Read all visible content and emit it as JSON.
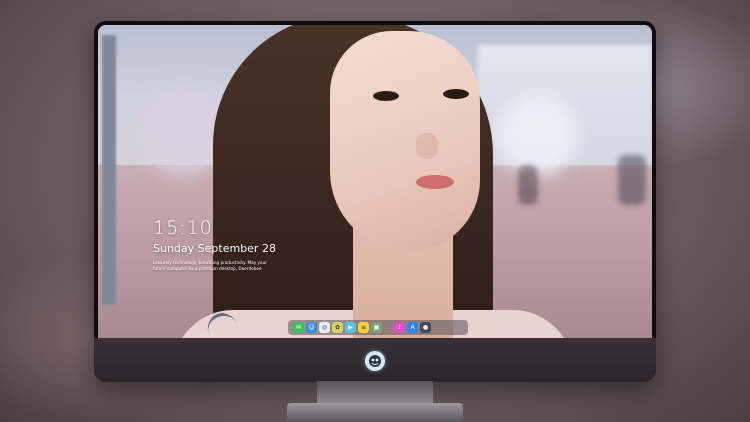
{
  "lockscreen": {
    "time": "15:10",
    "date": "Sunday September 28",
    "quote": "Leisurely technology, breathing productivity. May your future computer be a premium desktop, Deerdebee"
  },
  "dock": {
    "icons": [
      {
        "name": "messages-icon",
        "glyph": "✉",
        "color": "#3fbf5a"
      },
      {
        "name": "finder-icon",
        "glyph": "☺",
        "color": "#3a8fe0"
      },
      {
        "name": "safari-icon",
        "glyph": "◎",
        "color": "#e9eef5"
      },
      {
        "name": "photos-icon",
        "glyph": "✿",
        "color": "#d9d36a"
      },
      {
        "name": "facetime-icon",
        "glyph": "▶",
        "color": "#59c0e8"
      },
      {
        "name": "notes-icon",
        "glyph": "≡",
        "color": "#f2d23a"
      },
      {
        "name": "preview-icon",
        "glyph": "▣",
        "color": "#7aa37a"
      },
      {
        "name": "music-icon",
        "glyph": "♪",
        "color": "#e14bd0"
      },
      {
        "name": "app-store-icon",
        "glyph": "A",
        "color": "#2a86f5"
      },
      {
        "name": "camera-icon",
        "glyph": "●",
        "color": "#444a52"
      }
    ]
  },
  "colors": {
    "bezel": "#0d0d0f",
    "chin": "#2b2429",
    "accent": "#59c0e8"
  }
}
